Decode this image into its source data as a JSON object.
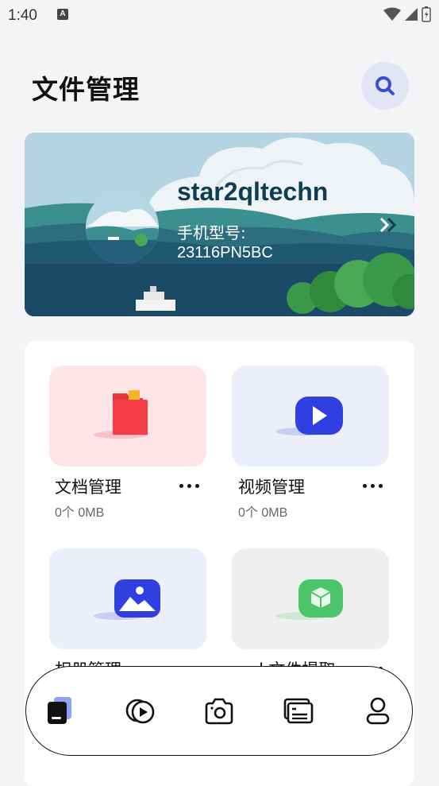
{
  "status_bar": {
    "time": "1:40",
    "notification_icon": "A"
  },
  "header": {
    "title": "文件管理",
    "search_icon": "search-icon"
  },
  "banner": {
    "user_name": "star2qltechn",
    "model_label": "手机型号:",
    "model_value": "23116PN5BC",
    "arrow_icon": "double-chevron-right-icon"
  },
  "categories": [
    {
      "label": "文档管理",
      "count": "0个  0MB",
      "icon": "folder-icon",
      "tile_color": "#fde4e6"
    },
    {
      "label": "视频管理",
      "count": "0个  0MB",
      "icon": "video-play-icon",
      "tile_color": "#eceef9"
    },
    {
      "label": "相册管理",
      "count": "",
      "icon": "image-icon",
      "tile_color": "#eceef9"
    },
    {
      "label": "apk文件提取",
      "count": "",
      "icon": "package-icon",
      "tile_color": "#efefef"
    }
  ],
  "bottom_nav": [
    {
      "icon": "file-manage-icon",
      "active": true
    },
    {
      "icon": "video-icon",
      "active": false
    },
    {
      "icon": "camera-icon",
      "active": false
    },
    {
      "icon": "card-icon",
      "active": false
    },
    {
      "icon": "profile-icon",
      "active": false
    }
  ]
}
